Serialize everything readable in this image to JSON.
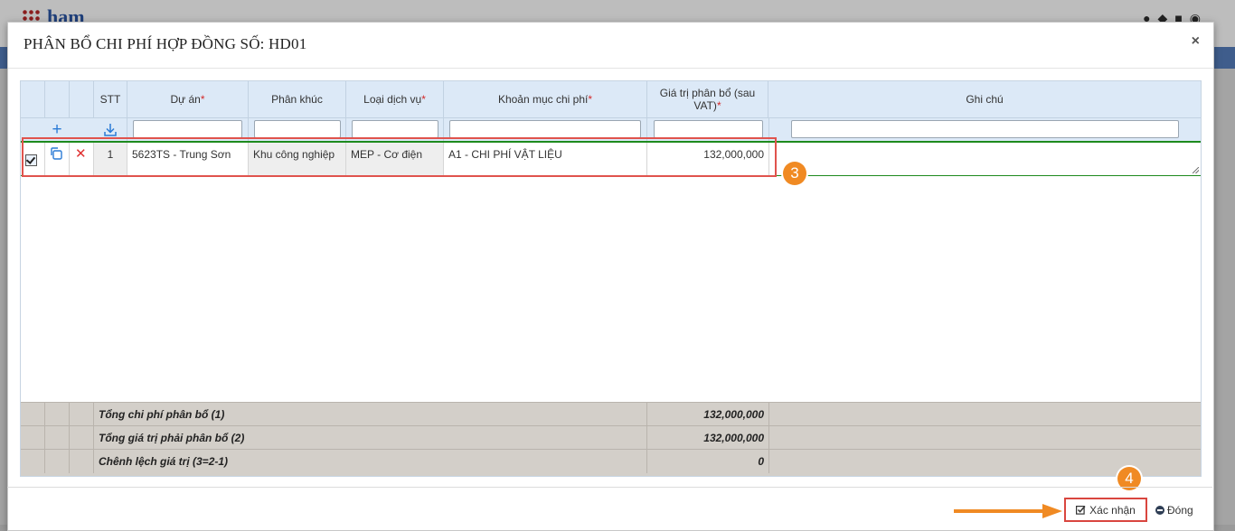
{
  "background": {
    "logo_text": "ham"
  },
  "modal": {
    "title": "PHÂN BỔ CHI PHÍ HỢP ĐỒNG SỐ: HD01",
    "close_symbol": "×"
  },
  "grid": {
    "headers": {
      "stt": "STT",
      "du_an": "Dự án",
      "phan_khuc": "Phân khúc",
      "loai_dich_vu": "Loại dịch vụ",
      "khoan_muc": "Khoản mục chi phí",
      "gia_tri": "Giá trị phân bổ (sau VAT)",
      "ghi_chu": "Ghi chú",
      "required_mark": "*"
    },
    "add_symbol": "+",
    "rows": [
      {
        "stt": "1",
        "du_an": "5623TS - Trung Sơn",
        "phan_khuc": "Khu công nghiệp",
        "loai_dich_vu": "MEP - Cơ điện",
        "khoan_muc": "A1 - CHI PHÍ VẬT LIỆU",
        "gia_tri": "132,000,000",
        "ghi_chu": "",
        "checked": true
      }
    ],
    "delete_symbol": "✕",
    "totals": [
      {
        "label": "Tổng chi phí phân bổ (1)",
        "value": "132,000,000"
      },
      {
        "label": "Tổng giá trị phải phân bổ (2)",
        "value": "132,000,000"
      },
      {
        "label": "Chênh lệch giá trị (3=2-1)",
        "value": "0"
      }
    ]
  },
  "annotations": {
    "badge_3": "3",
    "badge_4": "4"
  },
  "footer": {
    "confirm_label": "Xác nhận",
    "close_label": "Đóng"
  },
  "colors": {
    "header_bg": "#dce9f7",
    "totals_bg": "#d3cfc9",
    "highlight": "#e0534d",
    "badge": "#f08a23",
    "selected_row_border": "#1d8a1d"
  }
}
